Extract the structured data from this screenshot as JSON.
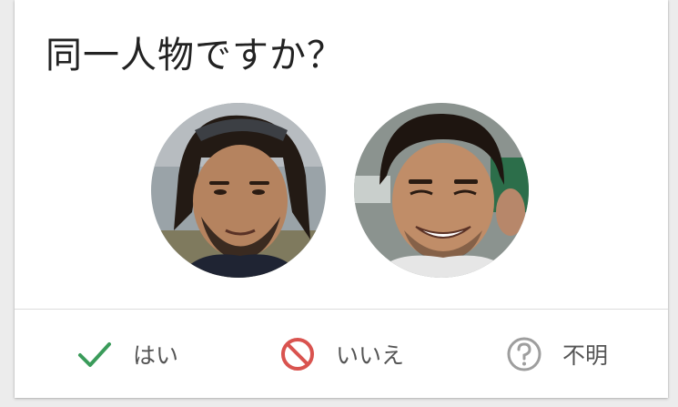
{
  "dialog": {
    "title": "同一人物ですか？"
  },
  "faces": [
    {
      "name": "face-photo-left"
    },
    {
      "name": "face-photo-right"
    }
  ],
  "actions": {
    "yes": {
      "label": "はい",
      "icon": "checkmark-icon",
      "color": "#3a9b5a"
    },
    "no": {
      "label": "いいえ",
      "icon": "prohibited-icon",
      "color": "#d9534f"
    },
    "unknown": {
      "label": "不明",
      "icon": "question-circle-icon",
      "color": "#9e9e9e"
    }
  }
}
